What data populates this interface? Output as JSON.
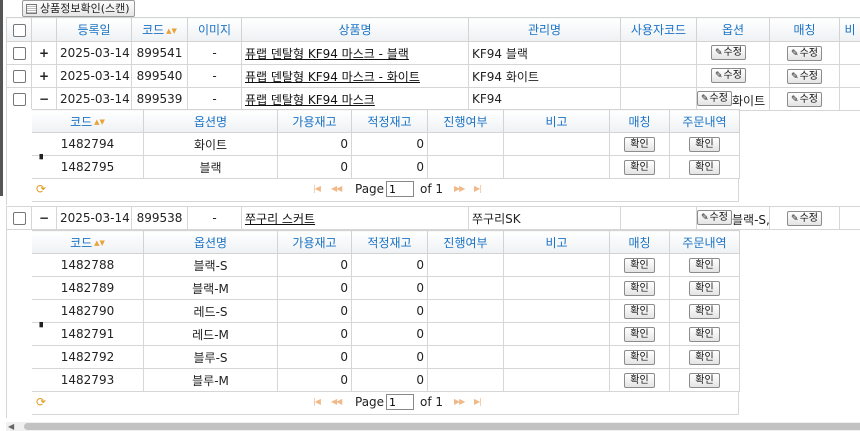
{
  "toolbar": {
    "scan_button": "상품정보확인(스캔)"
  },
  "main_headers": [
    "등록일",
    "코드",
    "이미지",
    "상품명",
    "관리명",
    "사용자코드",
    "옵션",
    "매칭",
    "비"
  ],
  "sort_icon": "▲▼",
  "edit_label": "수정",
  "products": [
    {
      "toggle": "+",
      "date": "2025-03-14",
      "code": "899541",
      "image": "-",
      "name": "퓨랩 덴탈형 KF94 마스크 - 블랙",
      "manage": "KF94 블랙",
      "usercode": "",
      "option_text": ""
    },
    {
      "toggle": "+",
      "date": "2025-03-14",
      "code": "899540",
      "image": "-",
      "name": "퓨랩 덴탈형 KF94 마스크 - 화이트",
      "manage": "KF94 화이트",
      "usercode": "",
      "option_text": ""
    },
    {
      "toggle": "−",
      "date": "2025-03-14",
      "code": "899539",
      "image": "-",
      "name": "퓨랩 덴탈형 KF94 마스크",
      "manage": "KF94",
      "usercode": "",
      "option_text": "화이트"
    },
    {
      "toggle": "−",
      "date": "2025-03-14",
      "code": "899538",
      "image": "-",
      "name": "쭈구리 스커트",
      "manage": "쭈구리SK",
      "usercode": "",
      "option_text": "블랙-S,"
    }
  ],
  "sub_headers": [
    "코드",
    "옵션명",
    "가용재고",
    "적정재고",
    "진행여부",
    "비고",
    "매칭",
    "주문내역"
  ],
  "confirm_label": "확인",
  "subgrid1": [
    {
      "code": "1482794",
      "option": "화이트",
      "avail": "0",
      "proper": "0",
      "progress": "",
      "note": ""
    },
    {
      "code": "1482795",
      "option": "블랙",
      "avail": "0",
      "proper": "0",
      "progress": "",
      "note": ""
    }
  ],
  "subgrid2": [
    {
      "code": "1482788",
      "option": "블랙-S",
      "avail": "0",
      "proper": "0",
      "progress": "",
      "note": ""
    },
    {
      "code": "1482789",
      "option": "블랙-M",
      "avail": "0",
      "proper": "0",
      "progress": "",
      "note": ""
    },
    {
      "code": "1482790",
      "option": "레드-S",
      "avail": "0",
      "proper": "0",
      "progress": "",
      "note": ""
    },
    {
      "code": "1482791",
      "option": "레드-M",
      "avail": "0",
      "proper": "0",
      "progress": "",
      "note": ""
    },
    {
      "code": "1482792",
      "option": "블루-S",
      "avail": "0",
      "proper": "0",
      "progress": "",
      "note": ""
    },
    {
      "code": "1482793",
      "option": "블루-M",
      "avail": "0",
      "proper": "0",
      "progress": "",
      "note": ""
    }
  ],
  "pager": {
    "page_label": "Page",
    "page_value": "1",
    "of_label": "of 1",
    "first": "|◀",
    "prev": "◀◀",
    "next": "▶▶",
    "last": "▶|",
    "refresh_icon": "⟳"
  },
  "colors": {
    "header_text": "#1b73c5",
    "pager_icon": "#e09a1c"
  }
}
